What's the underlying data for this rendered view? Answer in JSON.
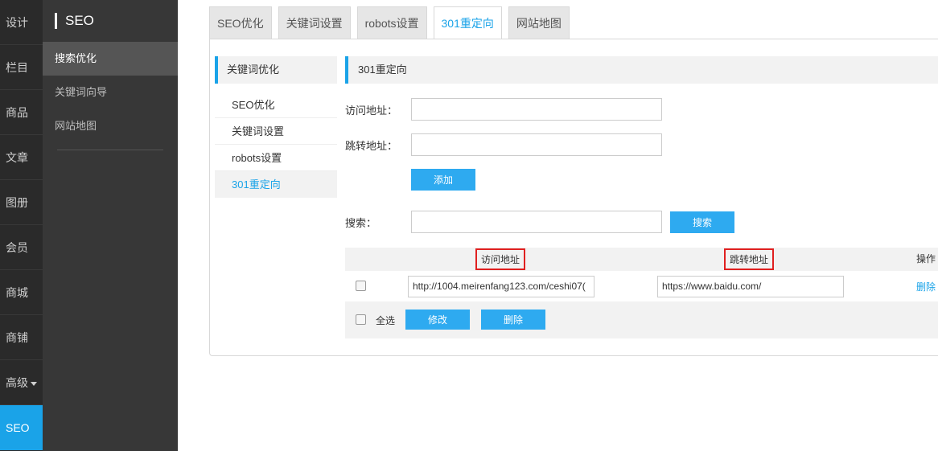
{
  "rail": {
    "items": [
      "设计",
      "栏目",
      "商品",
      "文章",
      "图册",
      "会员",
      "商城",
      "商铺",
      "高级",
      "SEO"
    ]
  },
  "sidebar": {
    "title": "SEO",
    "items": [
      "搜索优化",
      "关键词向导",
      "网站地图"
    ]
  },
  "tabs": [
    "SEO优化",
    "关键词设置",
    "robots设置",
    "301重定向",
    "网站地图"
  ],
  "subnav": {
    "title": "关键词优化",
    "items": [
      "SEO优化",
      "关键词设置",
      "robots设置",
      "301重定向"
    ]
  },
  "content": {
    "section_title": "301重定向",
    "visit_label": "访问地址：",
    "jump_label": "跳转地址：",
    "add_button": "添加",
    "search_label": "搜索：",
    "search_button": "搜索"
  },
  "table": {
    "col_visit": "访问地址",
    "col_jump": "跳转地址",
    "col_op": "操作",
    "rows": [
      {
        "visit": "http://1004.meirenfang123.com/ceshi07(",
        "jump": "https://www.baidu.com/",
        "action": "删除"
      }
    ],
    "select_all": "全选",
    "edit_button": "修改",
    "delete_button": "删除"
  },
  "colors": {
    "accent": "#1aa3e8",
    "highlight_border": "#e02020"
  }
}
